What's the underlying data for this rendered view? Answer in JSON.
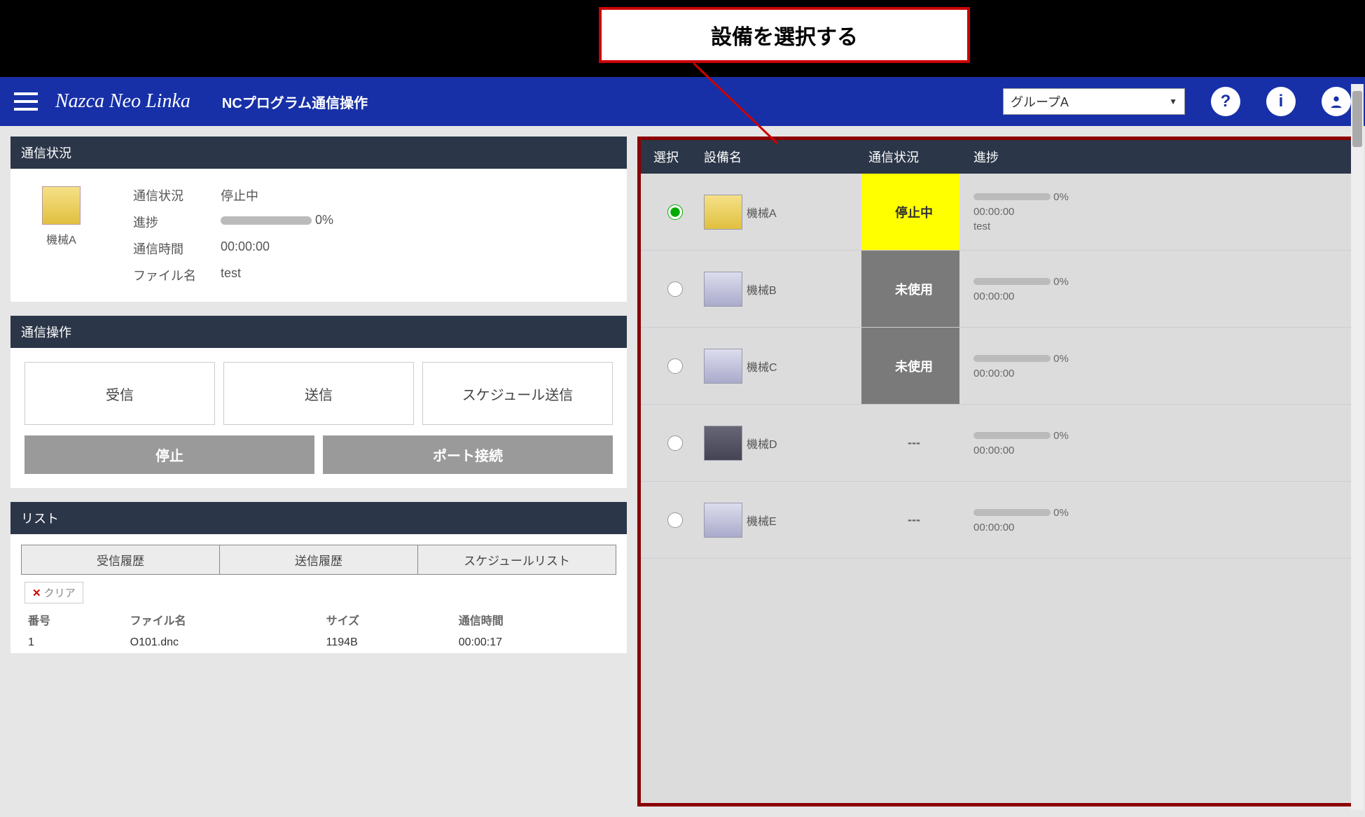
{
  "callout": {
    "text": "設備を選択する"
  },
  "header": {
    "app_title": "Nazca Neo Linka",
    "page_title": "NCプログラム通信操作",
    "group_selected": "グループA"
  },
  "status_panel": {
    "title": "通信状況",
    "machine_name": "機械A",
    "labels": {
      "status": "通信状況",
      "progress": "進捗",
      "time": "通信時間",
      "filename": "ファイル名"
    },
    "values": {
      "status": "停止中",
      "progress": "0%",
      "time": "00:00:00",
      "filename": "test"
    }
  },
  "ops_panel": {
    "title": "通信操作",
    "buttons": {
      "receive": "受信",
      "send": "送信",
      "schedule": "スケジュール送信",
      "stop": "停止",
      "port": "ポート接続"
    }
  },
  "list_panel": {
    "title": "リスト",
    "tabs": {
      "recv": "受信履歴",
      "send": "送信履歴",
      "sched": "スケジュールリスト"
    },
    "clear": "クリア",
    "columns": {
      "no": "番号",
      "file": "ファイル名",
      "size": "サイズ",
      "time": "通信時間"
    },
    "rows": [
      {
        "no": "1",
        "file": "O101.dnc",
        "size": "1194B",
        "time": "00:00:17"
      }
    ]
  },
  "equip_panel": {
    "columns": {
      "sel": "選択",
      "name": "設備名",
      "status": "通信状況",
      "prog": "進捗"
    },
    "rows": [
      {
        "name": "機械A",
        "status": "停止中",
        "status_kind": "yellow",
        "pct": "0%",
        "time": "00:00:00",
        "note": "test",
        "selected": true,
        "thumb": "yellow"
      },
      {
        "name": "機械B",
        "status": "未使用",
        "status_kind": "grey",
        "pct": "0%",
        "time": "00:00:00",
        "note": "",
        "selected": false,
        "thumb": "blue"
      },
      {
        "name": "機械C",
        "status": "未使用",
        "status_kind": "grey",
        "pct": "0%",
        "time": "00:00:00",
        "note": "",
        "selected": false,
        "thumb": "blue"
      },
      {
        "name": "機械D",
        "status": "---",
        "status_kind": "none",
        "pct": "0%",
        "time": "00:00:00",
        "note": "",
        "selected": false,
        "thumb": "dark"
      },
      {
        "name": "機械E",
        "status": "---",
        "status_kind": "none",
        "pct": "0%",
        "time": "00:00:00",
        "note": "",
        "selected": false,
        "thumb": "blue"
      }
    ]
  }
}
